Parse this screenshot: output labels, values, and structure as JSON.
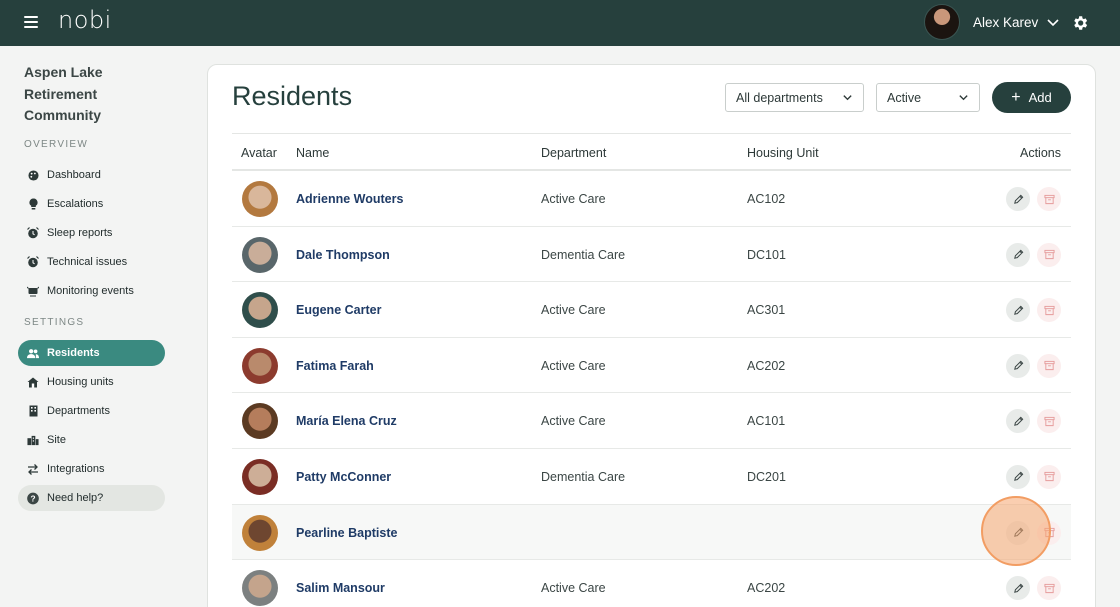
{
  "app": {
    "logo": "nobi",
    "user_name": "Alex Karev"
  },
  "sidebar": {
    "org_lines": [
      "Aspen Lake",
      "Retirement",
      "Community"
    ],
    "overview_label": "OVERVIEW",
    "settings_label": "SETTINGS",
    "overview_items": [
      {
        "label": "Dashboard",
        "icon": "palette-icon"
      },
      {
        "label": "Escalations",
        "icon": "lightbulb-icon"
      },
      {
        "label": "Sleep reports",
        "icon": "alarm-clock-icon"
      },
      {
        "label": "Technical issues",
        "icon": "alarm-clock-icon"
      },
      {
        "label": "Monitoring events",
        "icon": "monitor-icon"
      }
    ],
    "settings_items": [
      {
        "label": "Residents",
        "icon": "users-icon",
        "active": true
      },
      {
        "label": "Housing units",
        "icon": "house-icon"
      },
      {
        "label": "Departments",
        "icon": "building-icon"
      },
      {
        "label": "Site",
        "icon": "city-icon"
      },
      {
        "label": "Integrations",
        "icon": "arrows-icon"
      }
    ],
    "help_label": "Need help?"
  },
  "main": {
    "title": "Residents",
    "filters": {
      "department": "All departments",
      "status": "Active"
    },
    "add_label": "Add",
    "columns": {
      "avatar": "Avatar",
      "name": "Name",
      "department": "Department",
      "housing": "Housing Unit",
      "actions": "Actions"
    },
    "rows": [
      {
        "name": "Adrienne Wouters",
        "department": "Active Care",
        "unit": "AC102"
      },
      {
        "name": "Dale Thompson",
        "department": "Dementia Care",
        "unit": "DC101"
      },
      {
        "name": "Eugene Carter",
        "department": "Active Care",
        "unit": "AC301"
      },
      {
        "name": "Fatima Farah",
        "department": "Active Care",
        "unit": "AC202"
      },
      {
        "name": "María Elena Cruz",
        "department": "Active Care",
        "unit": "AC101"
      },
      {
        "name": "Patty McConner",
        "department": "Dementia Care",
        "unit": "DC201"
      },
      {
        "name": "Pearline Baptiste",
        "department": "",
        "unit": ""
      },
      {
        "name": "Salim Mansour",
        "department": "Active Care",
        "unit": "AC202"
      }
    ]
  },
  "colors": {
    "topbar": "#26403d",
    "accent": "#3a8a80",
    "link": "#1f3b66",
    "highlight": "#f29d63"
  }
}
